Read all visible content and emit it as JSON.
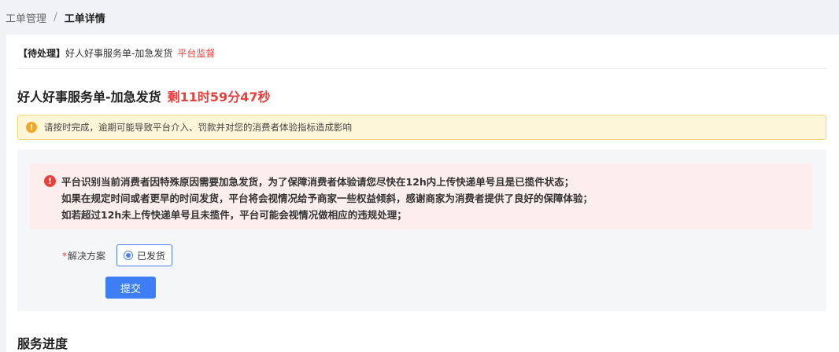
{
  "breadcrumb": {
    "parent": "工单管理",
    "separator": "/",
    "current": "工单详情"
  },
  "order": {
    "status_tag": "【待处理】",
    "name": "好人好事服务单-加急发货",
    "supervise_label": "平台监督",
    "title": "好人好事服务单-加急发货",
    "countdown": "剩11时59分47秒"
  },
  "warning": {
    "icon": "exclamation-icon",
    "text": "请按时完成，逾期可能导致平台介入、罚款并对您的消费者体验指标造成影响"
  },
  "alert": {
    "icon": "error-icon",
    "lines": [
      "平台识别当前消费者因特殊原因需要加急发货，为了保障消费者体验请您尽快在12h内上传快递单号且是已揽件状态；",
      "如果在规定时间或者更早的时间发货，平台将会视情况给予商家一些权益倾斜，感谢商家为消费者提供了良好的保障体验；",
      "如若超过12h未上传快递单号且未揽件，平台可能会视情况做相应的违规处理；"
    ]
  },
  "form": {
    "required_mark": "*",
    "label": "解决方案",
    "option_label": "已发货",
    "submit_label": "提交"
  },
  "progress": {
    "title": "服务进度"
  },
  "colors": {
    "accent": "#3d7ef4",
    "danger": "#e8403c",
    "warning": "#f5a623"
  }
}
